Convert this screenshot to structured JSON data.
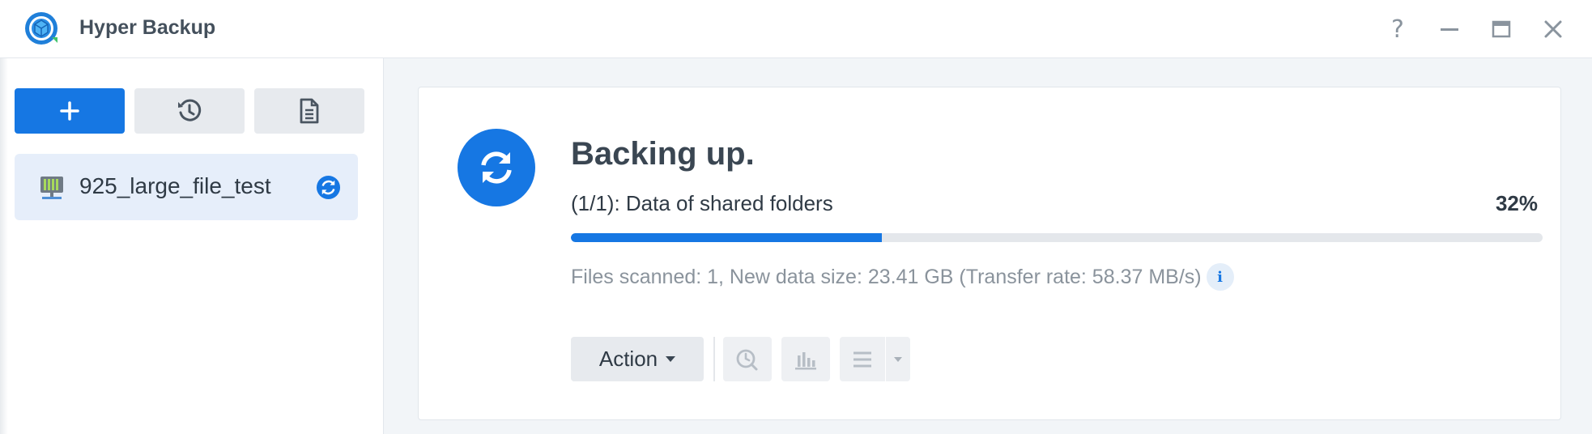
{
  "app": {
    "title": "Hyper Backup",
    "logo_icon": "hyper-backup-logo",
    "accent_color": "#1677e3"
  },
  "window_controls": {
    "help_label": "?",
    "minimize_icon": "minimize-icon",
    "maximize_icon": "maximize-icon",
    "close_icon": "close-icon"
  },
  "sidebar": {
    "toolbar": [
      {
        "icon": "plus-icon",
        "name": "add-task-button"
      },
      {
        "icon": "history-icon",
        "name": "restore-history-button"
      },
      {
        "icon": "document-icon",
        "name": "log-button"
      }
    ],
    "tasks": [
      {
        "name": "925_large_file_test",
        "icon": "nas-device-icon",
        "status_icon": "sync-icon",
        "selected": true
      }
    ]
  },
  "task_status": {
    "icon": "sync-icon",
    "title": "Backing up.",
    "detail": "(1/1): Data of shared folders",
    "progress_label": "32%",
    "progress_value": 0.32,
    "stats": "Files scanned: 1, New data size: 23.41 GB (Transfer rate: 58.37 MB/s)",
    "info_label": "i"
  },
  "actions": {
    "action_label": "Action",
    "tools": [
      {
        "icon": "timer-icon",
        "name": "backup-schedule-button",
        "enabled": false
      },
      {
        "icon": "bar-chart-icon",
        "name": "statistics-button",
        "enabled": false
      },
      {
        "icon": "list-icon",
        "name": "version-list-button",
        "enabled": false
      }
    ]
  }
}
